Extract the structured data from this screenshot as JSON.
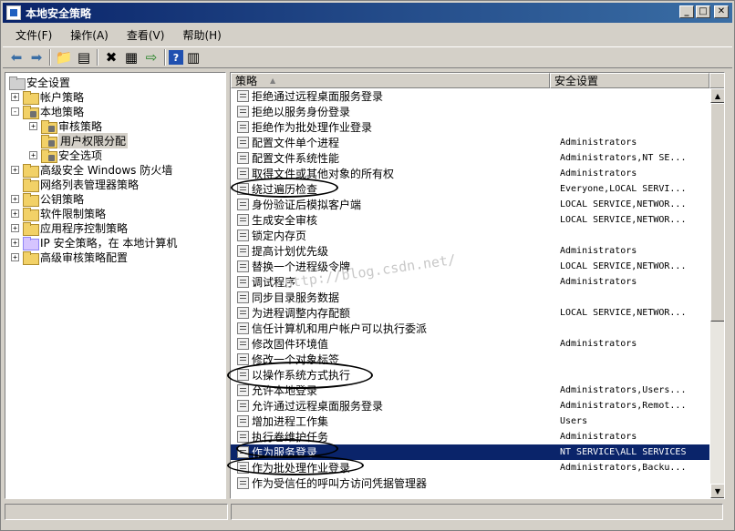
{
  "window": {
    "title": "本地安全策略"
  },
  "menu": [
    "文件(F)",
    "操作(A)",
    "查看(V)",
    "帮助(H)"
  ],
  "toolbar": [
    "back-icon",
    "forward-icon",
    "up-folder-icon",
    "show-tree-icon",
    "delete-icon",
    "properties-icon",
    "export-icon",
    "help-icon",
    "view-icon"
  ],
  "tree": [
    {
      "label": "安全设置",
      "depth": 0,
      "exp": "",
      "icon": "settings-icon"
    },
    {
      "label": "帐户策略",
      "depth": 1,
      "exp": "+",
      "icon": "folder-icon"
    },
    {
      "label": "本地策略",
      "depth": 1,
      "exp": "-",
      "icon": "folder-icon"
    },
    {
      "label": "审核策略",
      "depth": 2,
      "exp": "+",
      "icon": "folder-icon"
    },
    {
      "label": "用户权限分配",
      "depth": 2,
      "exp": "",
      "icon": "folder-icon",
      "selected": true
    },
    {
      "label": "安全选项",
      "depth": 2,
      "exp": "+",
      "icon": "folder-icon"
    },
    {
      "label": "高级安全 Windows 防火墙",
      "depth": 1,
      "exp": "+",
      "icon": "folder-icon"
    },
    {
      "label": "网络列表管理器策略",
      "depth": 1,
      "exp": "",
      "icon": "folder-icon"
    },
    {
      "label": "公钥策略",
      "depth": 1,
      "exp": "+",
      "icon": "folder-icon"
    },
    {
      "label": "软件限制策略",
      "depth": 1,
      "exp": "+",
      "icon": "folder-icon"
    },
    {
      "label": "应用程序控制策略",
      "depth": 1,
      "exp": "+",
      "icon": "folder-icon"
    },
    {
      "label": "IP 安全策略，在 本地计算机",
      "depth": 1,
      "exp": "+",
      "icon": "ip-policy-icon"
    },
    {
      "label": "高级审核策略配置",
      "depth": 1,
      "exp": "+",
      "icon": "folder-icon"
    }
  ],
  "columns": {
    "policy": "策略",
    "setting": "安全设置"
  },
  "rows": [
    {
      "policy": "拒绝通过远程桌面服务登录",
      "setting": ""
    },
    {
      "policy": "拒绝以服务身份登录",
      "setting": ""
    },
    {
      "policy": "拒绝作为批处理作业登录",
      "setting": ""
    },
    {
      "policy": "配置文件单个进程",
      "setting": "Administrators"
    },
    {
      "policy": "配置文件系统性能",
      "setting": "Administrators,NT SE..."
    },
    {
      "policy": "取得文件或其他对象的所有权",
      "setting": "Administrators"
    },
    {
      "policy": "绕过遍历检查",
      "setting": "Everyone,LOCAL SERVI..."
    },
    {
      "policy": "身份验证后模拟客户端",
      "setting": "LOCAL SERVICE,NETWOR..."
    },
    {
      "policy": "生成安全审核",
      "setting": "LOCAL SERVICE,NETWOR..."
    },
    {
      "policy": "锁定内存页",
      "setting": ""
    },
    {
      "policy": "提高计划优先级",
      "setting": "Administrators"
    },
    {
      "policy": "替换一个进程级令牌",
      "setting": "LOCAL SERVICE,NETWOR..."
    },
    {
      "policy": "调试程序",
      "setting": "Administrators"
    },
    {
      "policy": "同步目录服务数据",
      "setting": ""
    },
    {
      "policy": "为进程调整内存配额",
      "setting": "LOCAL SERVICE,NETWOR..."
    },
    {
      "policy": "信任计算机和用户帐户可以执行委派",
      "setting": ""
    },
    {
      "policy": "修改固件环境值",
      "setting": "Administrators"
    },
    {
      "policy": "修改一个对象标签",
      "setting": ""
    },
    {
      "policy": "以操作系统方式执行",
      "setting": ""
    },
    {
      "policy": "允许本地登录",
      "setting": "Administrators,Users..."
    },
    {
      "policy": "允许通过远程桌面服务登录",
      "setting": "Administrators,Remot..."
    },
    {
      "policy": "增加进程工作集",
      "setting": "Users"
    },
    {
      "policy": "执行卷维护任务",
      "setting": "Administrators"
    },
    {
      "policy": "作为服务登录",
      "setting": "NT SERVICE\\ALL SERVICES",
      "selected": true
    },
    {
      "policy": "作为批处理作业登录",
      "setting": "Administrators,Backu..."
    },
    {
      "policy": "作为受信任的呼叫方访问凭据管理器",
      "setting": ""
    }
  ],
  "watermark": "http://blog.csdn.net/",
  "colors": {
    "title": "#0a246a",
    "selection": "#0a246a",
    "folder": "#f2d167"
  }
}
